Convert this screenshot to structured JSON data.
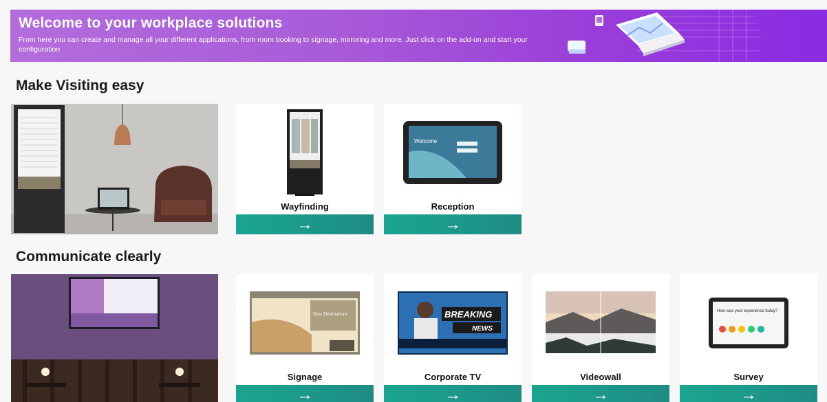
{
  "banner": {
    "title": "Welcome to your workplace solutions",
    "description": "From here you can create and manage all your different applications, from room booking to signage, mirroring and more. Just click on the add-on and start your configuration"
  },
  "sections": [
    {
      "title": "Make Visiting easy",
      "cards": [
        {
          "label": "Wayfinding",
          "arrow": "→"
        },
        {
          "label": "Reception",
          "arrow": "→"
        }
      ]
    },
    {
      "title": "Communicate clearly",
      "cards": [
        {
          "label": "Signage",
          "arrow": "→"
        },
        {
          "label": "Corporate TV",
          "arrow": "→"
        },
        {
          "label": "Videowall",
          "arrow": "→"
        },
        {
          "label": "Survey",
          "arrow": "→"
        }
      ]
    }
  ],
  "thumbs": {
    "reception_screen": "Welcome",
    "signage_screen": "New Destinations",
    "news_screen_top": "BREAKING",
    "news_screen_bottom": "NEWS",
    "survey_screen": "How was your experience today?"
  },
  "colors": {
    "accent": "#1aa58f",
    "banner_start": "#b36cdc",
    "banner_end": "#8a2be2"
  }
}
